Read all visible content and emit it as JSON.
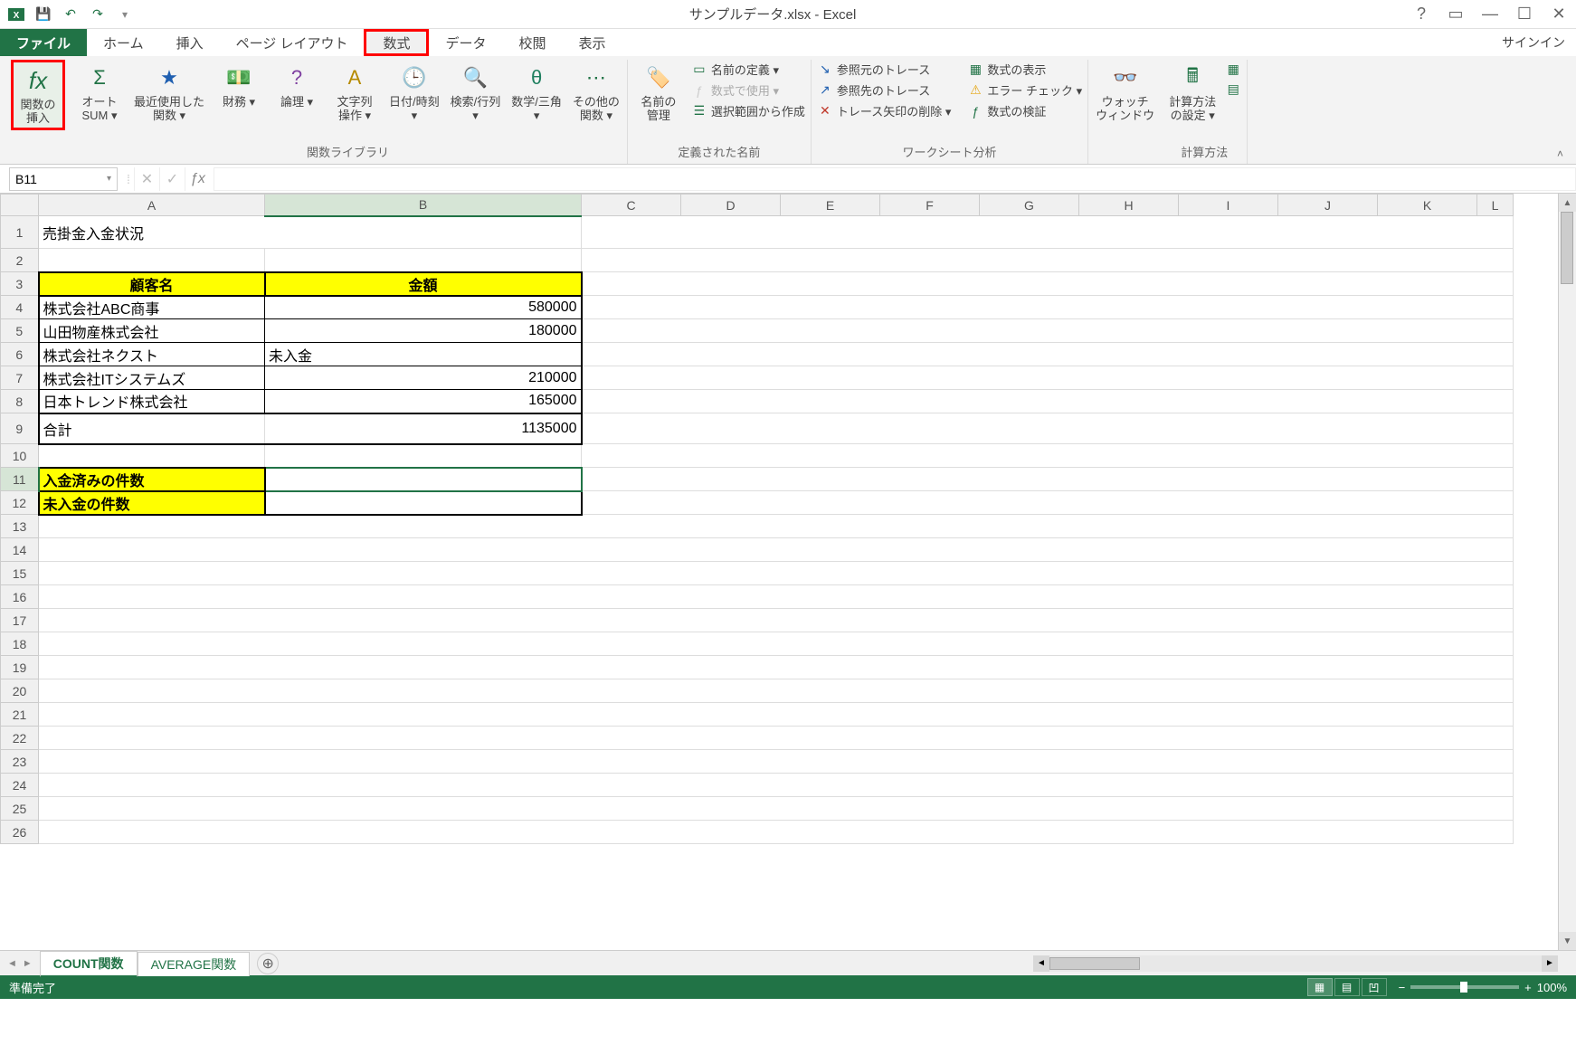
{
  "titlebar": {
    "title": "サンプルデータ.xlsx - Excel"
  },
  "tabs": {
    "file": "ファイル",
    "home": "ホーム",
    "insert": "挿入",
    "pagelayout": "ページ レイアウト",
    "formulas": "数式",
    "data": "データ",
    "review": "校閲",
    "view": "表示",
    "signin": "サインイン"
  },
  "ribbon": {
    "insert_function": "関数の\n挿入",
    "autosum": "オート\nSUM ▾",
    "recent": "最近使用した\n関数 ▾",
    "financial": "財務 ▾",
    "logical": "論理 ▾",
    "text": "文字列\n操作 ▾",
    "datetime": "日付/時刻\n▾",
    "lookup": "検索/行列\n▾",
    "math": "数学/三角\n▾",
    "more": "その他の\n関数 ▾",
    "group_library": "関数ライブラリ",
    "name_manager": "名前の\n管理",
    "define_name": "名前の定義 ▾",
    "use_in_formula": "数式で使用 ▾",
    "create_from_selection": "選択範囲から作成",
    "group_names": "定義された名前",
    "trace_precedents": "参照元のトレース",
    "trace_dependents": "参照先のトレース",
    "remove_arrows": "トレース矢印の削除 ▾",
    "show_formulas": "数式の表示",
    "error_checking": "エラー チェック ▾",
    "evaluate_formula": "数式の検証",
    "group_audit": "ワークシート分析",
    "watch_window": "ウォッチ\nウィンドウ",
    "calc_options": "計算方法\nの設定 ▾",
    "group_calc": "計算方法"
  },
  "namebox": "B11",
  "columns": [
    "",
    "A",
    "B",
    "C",
    "D",
    "E",
    "F",
    "G",
    "H",
    "I",
    "J",
    "K",
    "L"
  ],
  "rows": {
    "title": "売掛金入金状況",
    "h_customer": "顧客名",
    "h_amount": "金額",
    "r4a": "株式会社ABC商事",
    "r4b": "580000",
    "r5a": "山田物産株式会社",
    "r5b": "180000",
    "r6a": "株式会社ネクスト",
    "r6b": "未入金",
    "r7a": "株式会社ITシステムズ",
    "r7b": "210000",
    "r8a": "日本トレンド株式会社",
    "r8b": "165000",
    "r9a": "合計",
    "r9b": "1135000",
    "r11a": "入金済みの件数",
    "r12a": "未入金の件数"
  },
  "sheets": {
    "s1": "COUNT関数",
    "s2": "AVERAGE関数"
  },
  "status": {
    "ready": "準備完了",
    "zoom": "100%"
  }
}
